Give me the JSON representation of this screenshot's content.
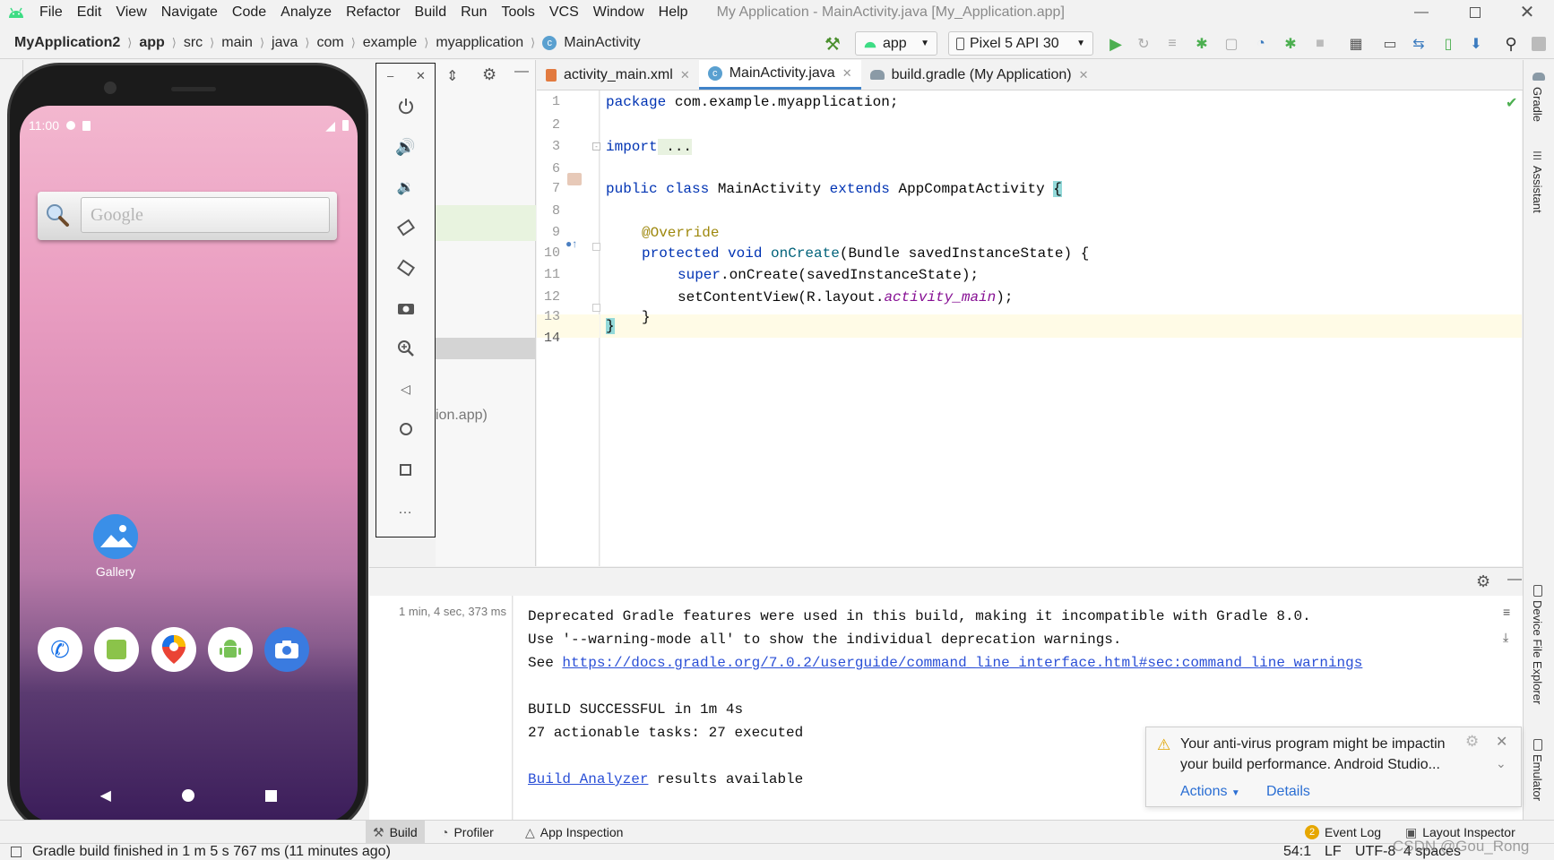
{
  "menubar": {
    "items": [
      {
        "label": "File"
      },
      {
        "label": "Edit"
      },
      {
        "label": "View"
      },
      {
        "label": "Navigate"
      },
      {
        "label": "Code"
      },
      {
        "label": "Analyze"
      },
      {
        "label": "Refactor"
      },
      {
        "label": "Build"
      },
      {
        "label": "Run"
      },
      {
        "label": "Tools"
      },
      {
        "label": "VCS"
      },
      {
        "label": "Window"
      },
      {
        "label": "Help"
      }
    ],
    "window_title": "My Application - MainActivity.java [My_Application.app]"
  },
  "breadcrumbs": [
    "MyApplication2",
    "app",
    "src",
    "main",
    "java",
    "com",
    "example",
    "myapplication",
    "MainActivity"
  ],
  "toolbar": {
    "run_config": "app",
    "device": "Pixel 5 API 30"
  },
  "phone": {
    "time": "11:00",
    "search_placeholder": "Google",
    "gallery_label": "Gallery"
  },
  "project_panel": {
    "fragment": "ion.app)"
  },
  "tabs": [
    {
      "label": "activity_main.xml",
      "active": false
    },
    {
      "label": "MainActivity.java",
      "active": true
    },
    {
      "label": "build.gradle (My Application)",
      "active": false
    }
  ],
  "code_lines": [
    {
      "num": "1",
      "text": ""
    },
    {
      "num": "2",
      "text": ""
    },
    {
      "num": "3",
      "text": ""
    },
    {
      "num": "6",
      "text": ""
    },
    {
      "num": "7",
      "text": ""
    },
    {
      "num": "8",
      "text": ""
    },
    {
      "num": "9",
      "text": ""
    },
    {
      "num": "10",
      "text": ""
    },
    {
      "num": "11",
      "text": ""
    },
    {
      "num": "12",
      "text": ""
    },
    {
      "num": "13",
      "text": ""
    },
    {
      "num": "14",
      "text": ""
    }
  ],
  "code": {
    "l1_kw": "package",
    "l1_rest": " com.example.myapplication;",
    "l3_kw": "import",
    "l3_rest": " ...",
    "l7_kw1": "public class",
    "l7_mid": " MainActivity ",
    "l7_kw2": "extends",
    "l7_rest": " AppCompatActivity ",
    "l7_brace": "{",
    "l9_ann": "@Override",
    "l10_kw": "protected void",
    "l10_fn": " onCreate",
    "l10_rest": "(Bundle savedInstanceState) {",
    "l11_kw": "super",
    "l11_rest": ".onCreate(savedInstanceState);",
    "l12_a": "setContentView(R.layout.",
    "l12_it": "activity_main",
    "l12_b": ");",
    "l13": "}",
    "l14": "}"
  },
  "build": {
    "duration": "1 min, 4 sec, 373 ms",
    "line1": "Deprecated Gradle features were used in this build, making it incompatible with Gradle 8.0.",
    "line2": "Use '--warning-mode all' to show the individual deprecation warnings.",
    "line3_prefix": "See ",
    "line3_link": "https://docs.gradle.org/7.0.2/userguide/command_line_interface.html#sec:command_line_warnings",
    "line4": "BUILD SUCCESSFUL in 1m 4s",
    "line5": "27 actionable tasks: 27 executed",
    "line6_link": "Build Analyzer",
    "line6_rest": " results available"
  },
  "notification": {
    "line1": "Your anti-virus program might be impactin",
    "line2": "your build performance. Android Studio...",
    "action1": "Actions",
    "action2": "Details"
  },
  "bottom_tools": {
    "build": "Build",
    "profiler": "Profiler",
    "app_inspection": "App Inspection",
    "event_log_count": "2",
    "event_log": "Event Log",
    "layout_inspector": "Layout Inspector"
  },
  "right_strip": {
    "gradle": "Gradle",
    "assistant": "Assistant",
    "device_file_explorer": "Device File Explorer",
    "emulator": "Emulator"
  },
  "status": {
    "message": "Gradle build finished in 1 m 5 s 767 ms (11 minutes ago)",
    "position": "54:1",
    "line_sep": "LF",
    "encoding": "UTF-8",
    "indent": "4 spaces",
    "watermark": "CSDN @Gou_Rong"
  }
}
